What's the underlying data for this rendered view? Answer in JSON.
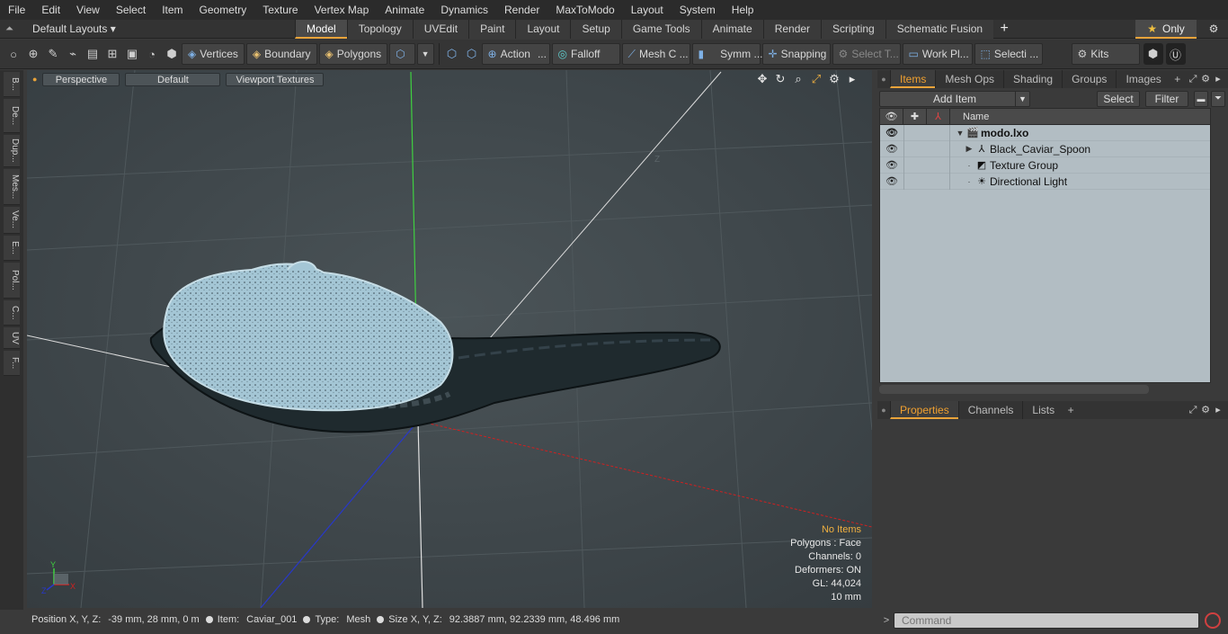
{
  "menu": [
    "File",
    "Edit",
    "View",
    "Select",
    "Item",
    "Geometry",
    "Texture",
    "Vertex Map",
    "Animate",
    "Dynamics",
    "Render",
    "MaxToModo",
    "Layout",
    "System",
    "Help"
  ],
  "layout_selector": "Default Layouts ▾",
  "layout_tabs": [
    "Model",
    "Topology",
    "UVEdit",
    "Paint",
    "Layout",
    "Setup",
    "Game Tools",
    "Animate",
    "Render",
    "Scripting",
    "Schematic Fusion"
  ],
  "only_label": "Only",
  "toolbar": {
    "vertices": "Vertices",
    "boundary": "Boundary",
    "polygons": "Polygons",
    "action": "Action",
    "falloff": "Falloff",
    "mesh": "Mesh C ...",
    "symm": "Symm ...",
    "snapping": "Snapping",
    "select_t": "Select T...",
    "work_pl": "Work Pl...",
    "selecti": "Selecti ...",
    "kits": "Kits"
  },
  "left_strip": [
    "B...",
    "De...",
    "Dup...",
    "Mes...",
    "Ve...",
    "E...",
    "Pol...",
    "C...",
    "UV",
    "F..."
  ],
  "viewport": {
    "view_mode": "Perspective",
    "shading": "Default",
    "textures": "Viewport Textures",
    "info": {
      "no_items": "No Items",
      "polygons": "Polygons : Face",
      "channels": "Channels: 0",
      "deformers": "Deformers: ON",
      "gl": "GL: 44,024",
      "scale": "10 mm"
    },
    "axis_y": "Y",
    "axis_x": "X",
    "axis_z": "Z"
  },
  "status": {
    "position_label": "Position X, Y, Z:",
    "position_value": "-39 mm, 28 mm, 0 m",
    "item_label": "Item:",
    "item_value": "Caviar_001",
    "type_label": "Type:",
    "type_value": "Mesh",
    "size_label": "Size X, Y, Z:",
    "size_value": "92.3887 mm, 92.2339 mm, 48.496 mm"
  },
  "items_tabs": [
    "Items",
    "Mesh Ops",
    "Shading",
    "Groups",
    "Images"
  ],
  "items_panel": {
    "add_item": "Add Item",
    "select": "Select",
    "filter": "Filter",
    "name_header": "Name",
    "tree": [
      {
        "name": "modo.lxo",
        "icon": "scene-icon",
        "glyph": "🎬"
      },
      {
        "name": "Black_Caviar_Spoon",
        "icon": "mesh-icon",
        "glyph": "⅄"
      },
      {
        "name": "Texture Group",
        "icon": "texture-group-icon",
        "glyph": "◩"
      },
      {
        "name": "Directional Light",
        "icon": "light-icon",
        "glyph": "☀"
      }
    ]
  },
  "props_tabs": [
    "Properties",
    "Channels",
    "Lists"
  ],
  "command": {
    "placeholder": "Command"
  },
  "colors": {
    "accent": "#e8a33a",
    "caviar": "#9ec3d3",
    "spoon": "#1f2a2e",
    "y_axis": "#3fd040",
    "x_axis": "#d02020",
    "z_axis": "#2030c0"
  }
}
